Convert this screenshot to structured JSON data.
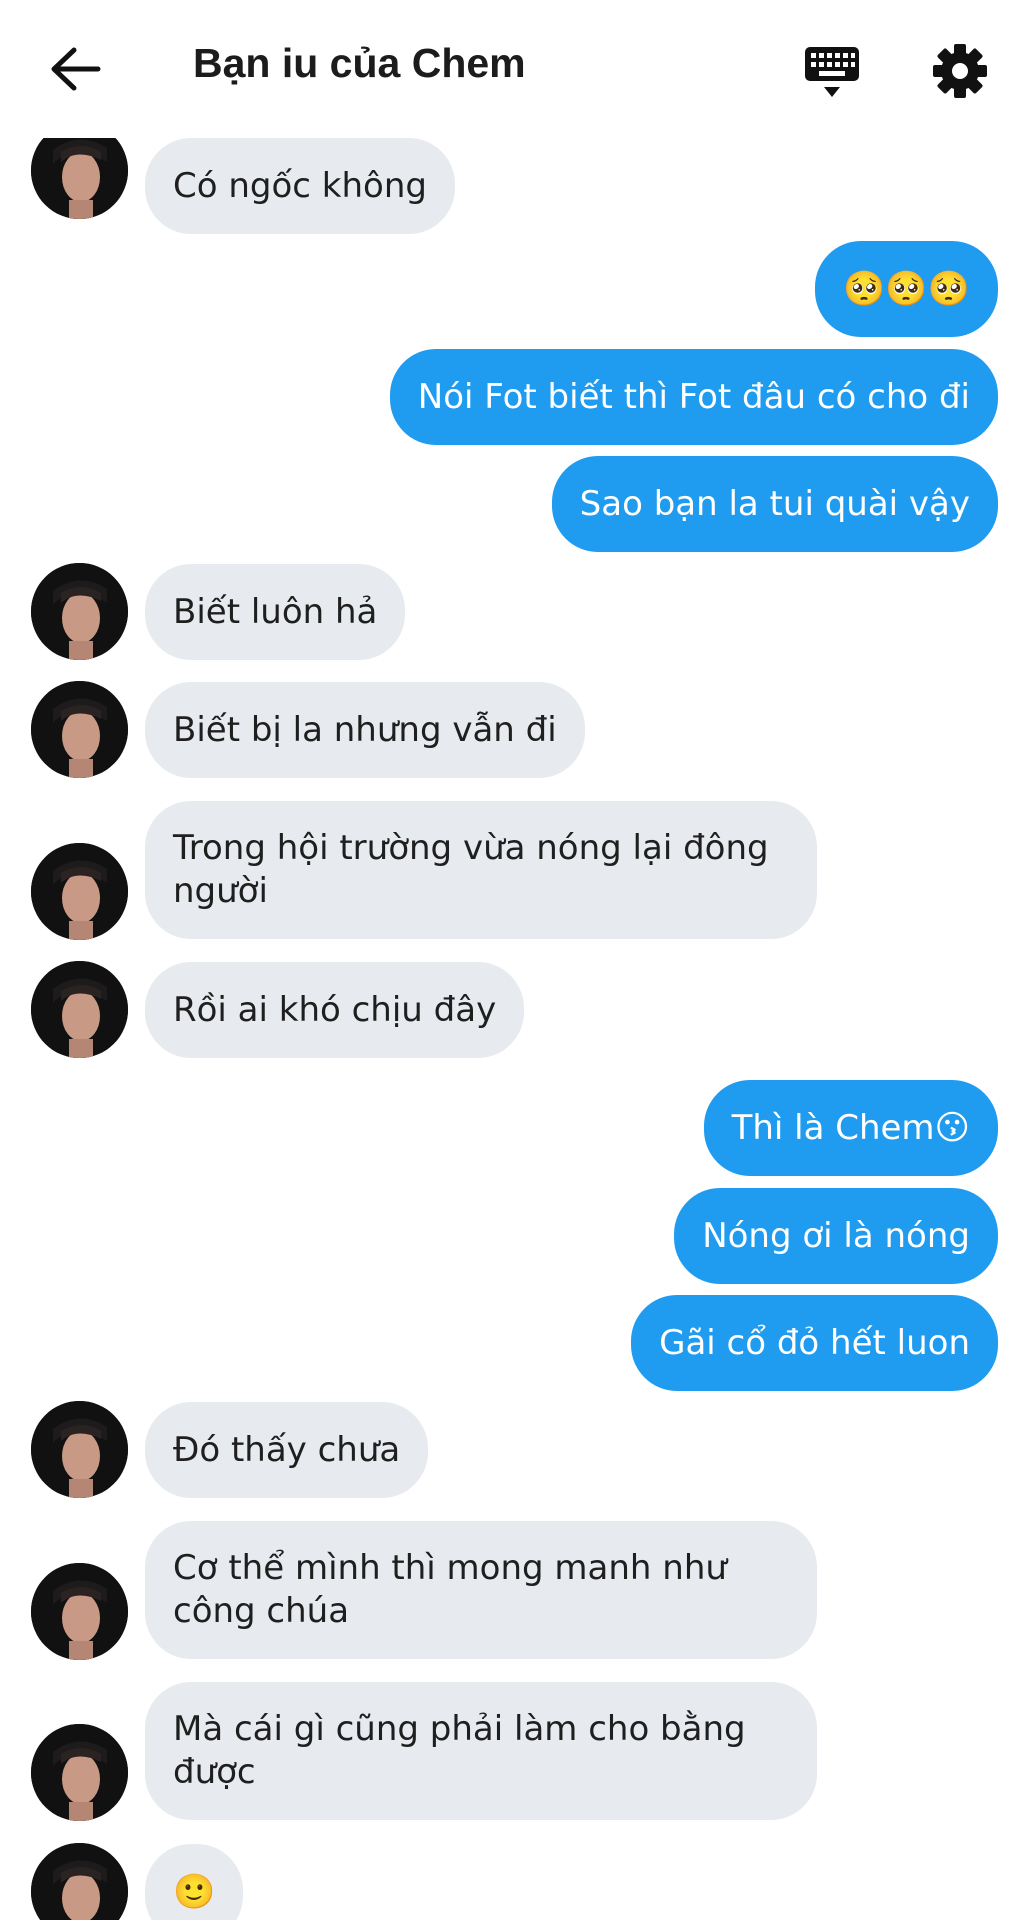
{
  "header": {
    "title": "Bạn iu của Chem",
    "back_icon": "arrow-left-icon",
    "keyboard_icon": "keyboard-icon",
    "settings_icon": "gear-icon"
  },
  "colors": {
    "sent_bubble": "#1f9bef",
    "received_bubble": "#e7eaee",
    "text_dark": "#1f1f1f"
  },
  "messages": [
    {
      "side": "received",
      "text": "Có ngốc không"
    },
    {
      "side": "sent",
      "text": "🥺🥺🥺"
    },
    {
      "side": "sent",
      "text": "Nói Fot biết thì Fot đâu có cho đi"
    },
    {
      "side": "sent",
      "text": "Sao bạn la tui quài vậy"
    },
    {
      "side": "received",
      "text": "Biết luôn hả"
    },
    {
      "side": "received",
      "text": "Biết bị la nhưng vẫn đi"
    },
    {
      "side": "received",
      "text": "Trong hội trường vừa nóng lại đông người"
    },
    {
      "side": "received",
      "text": "Rồi ai khó chịu đây"
    },
    {
      "side": "sent",
      "text": "Thì là Chem😗"
    },
    {
      "side": "sent",
      "text": "Nóng ơi là nóng"
    },
    {
      "side": "sent",
      "text": "Gãi cổ đỏ hết luon"
    },
    {
      "side": "received",
      "text": "Đó thấy chưa"
    },
    {
      "side": "received",
      "text": "Cơ thể mình thì mong manh như công chúa"
    },
    {
      "side": "received",
      "text": "Mà cái gì cũng phải làm cho bằng được"
    },
    {
      "side": "received",
      "text": "🙂"
    }
  ]
}
